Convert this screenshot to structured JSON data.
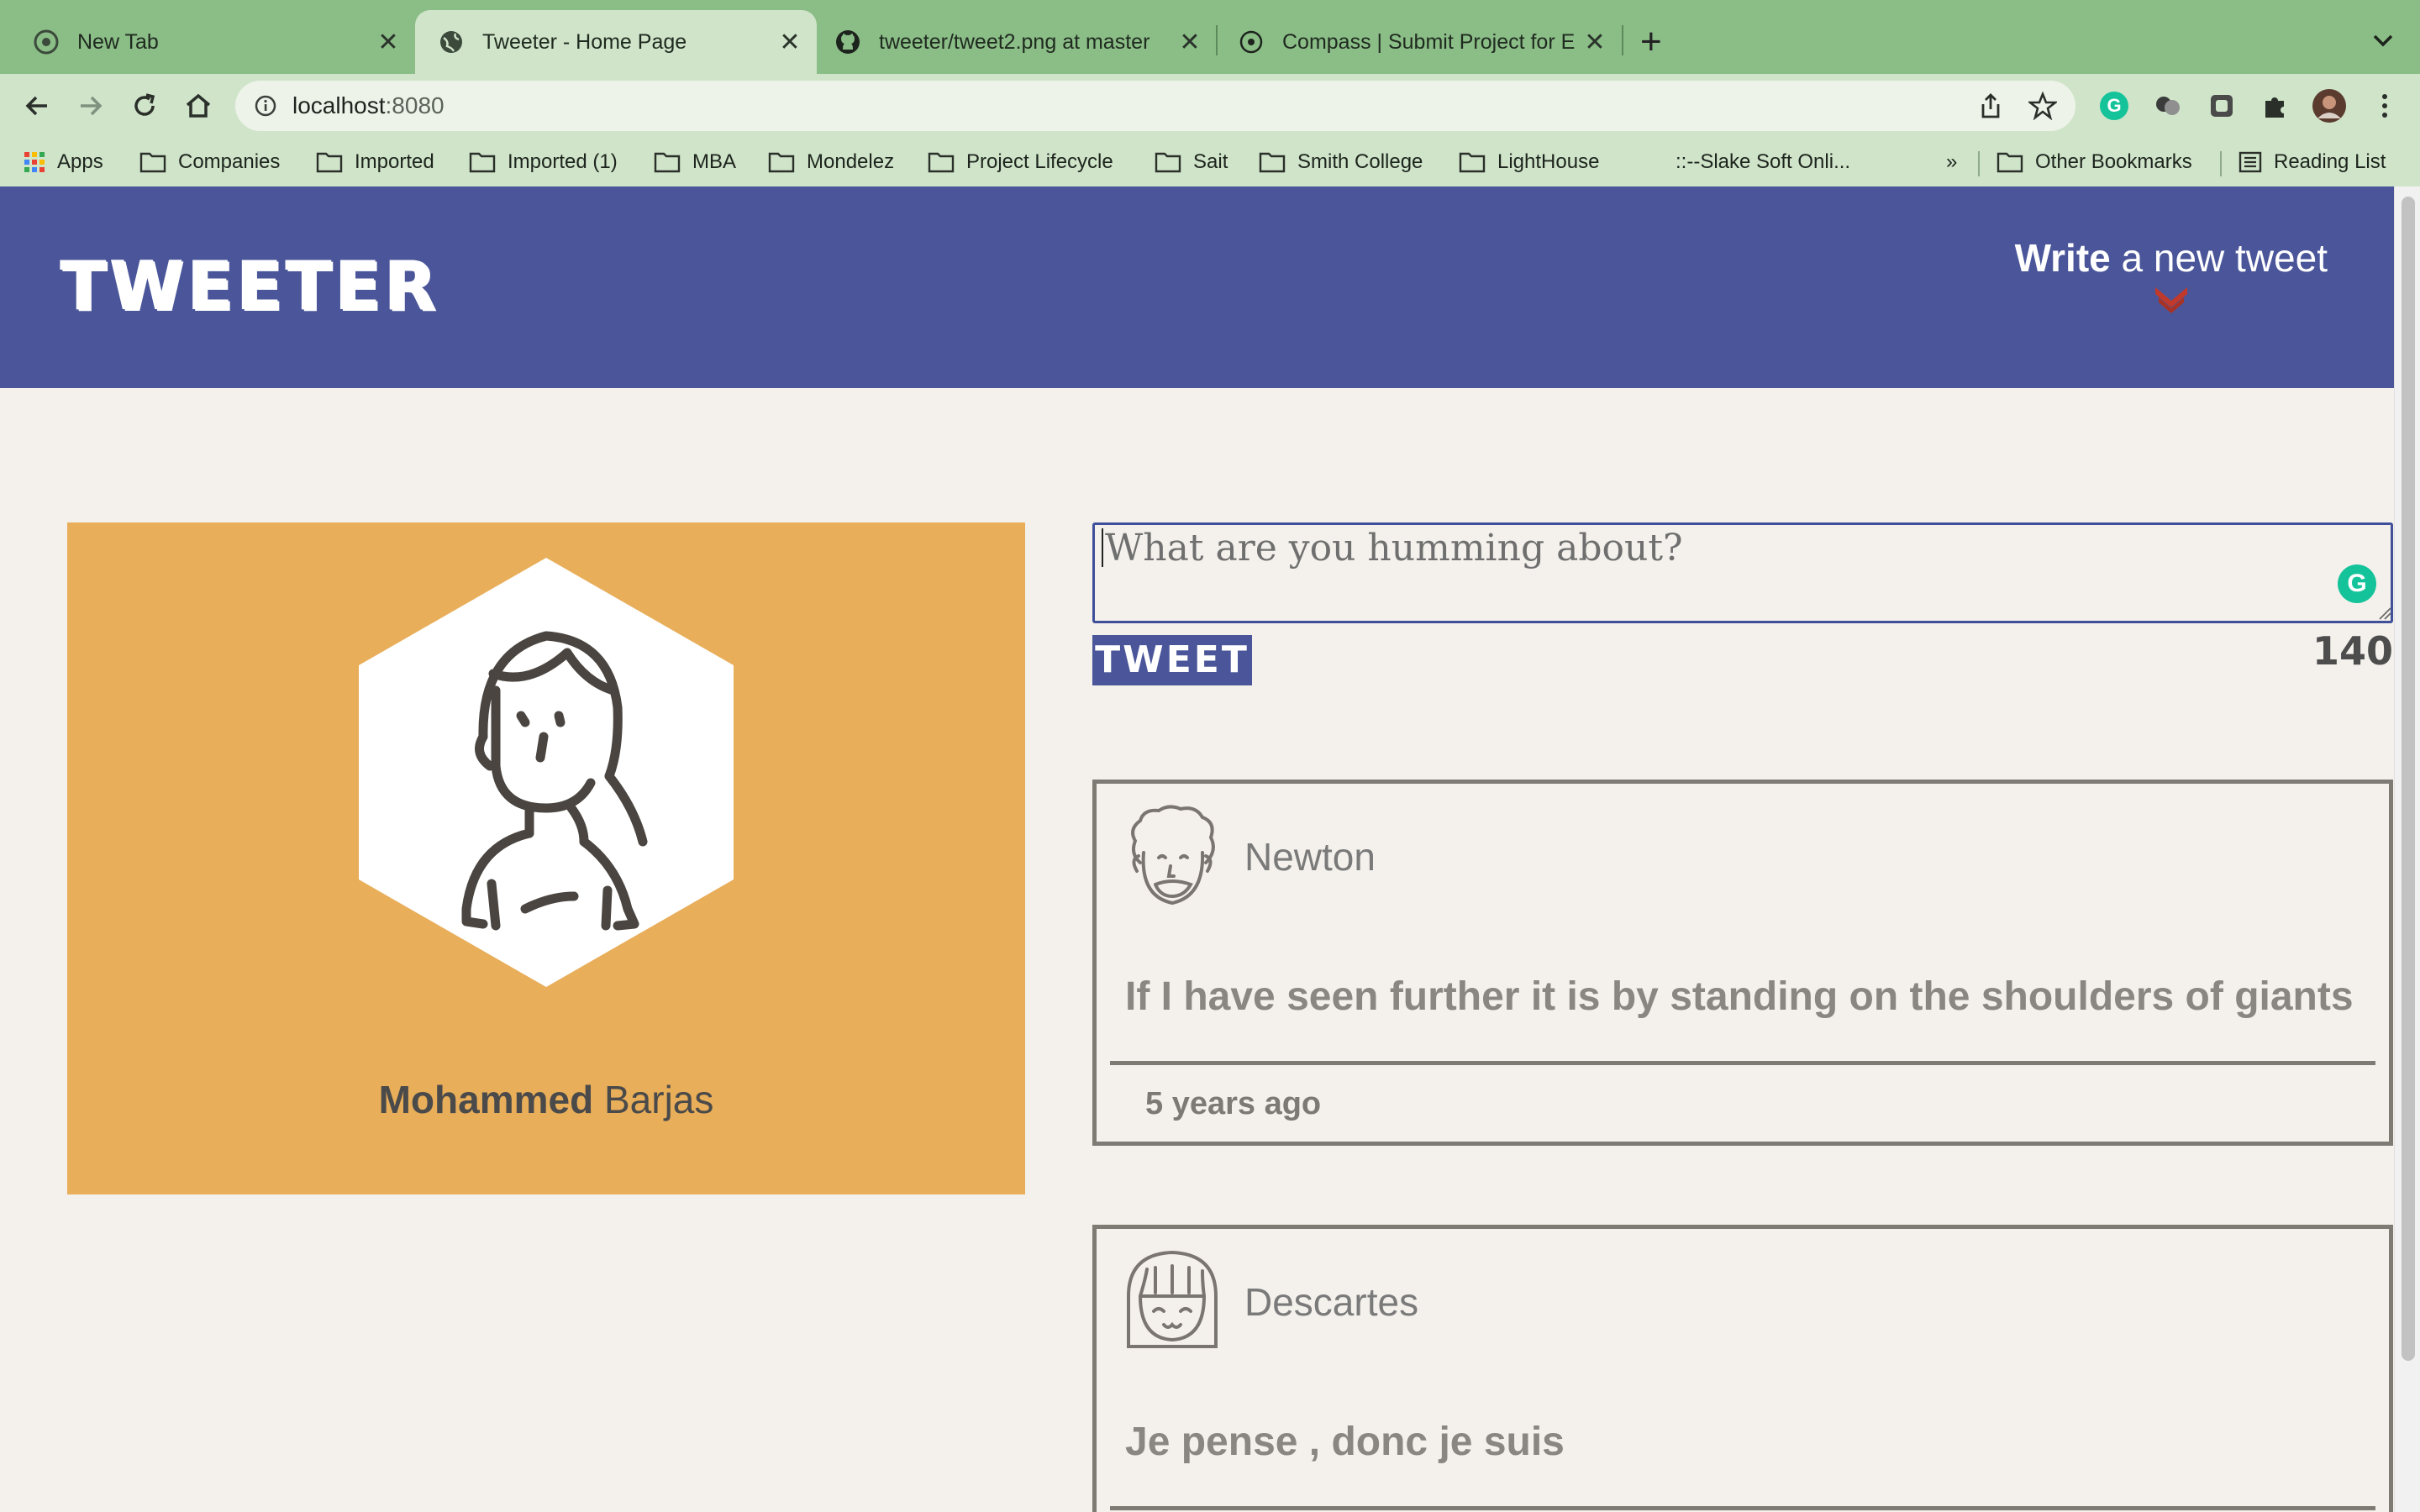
{
  "browser": {
    "tabs": [
      {
        "title": "New Tab",
        "icon": "chrome-icon",
        "active": false
      },
      {
        "title": "Tweeter - Home Page",
        "icon": "globe-icon",
        "active": true
      },
      {
        "title": "tweeter/tweet2.png at master",
        "icon": "github-icon",
        "active": false
      },
      {
        "title": "Compass | Submit Project for E",
        "icon": "compass-icon",
        "active": false
      }
    ],
    "new_tab_label": "+",
    "url_host": "localhost",
    "url_port": ":8080",
    "bookmarks": [
      {
        "label": "Apps",
        "icon": "apps-grid-icon"
      },
      {
        "label": "Companies",
        "icon": "folder-icon"
      },
      {
        "label": "Imported",
        "icon": "folder-icon"
      },
      {
        "label": "Imported (1)",
        "icon": "folder-icon"
      },
      {
        "label": "MBA",
        "icon": "folder-icon"
      },
      {
        "label": "Mondelez",
        "icon": "folder-icon"
      },
      {
        "label": "Project Lifecycle",
        "icon": "folder-icon"
      },
      {
        "label": "Sait",
        "icon": "folder-icon"
      },
      {
        "label": "Smith College",
        "icon": "folder-icon"
      },
      {
        "label": "LightHouse",
        "icon": "folder-icon"
      },
      {
        "label": "::--Slake Soft Onli...",
        "icon": "none"
      }
    ],
    "bookmarks_overflow": "»",
    "other_bookmarks": "Other Bookmarks",
    "reading_list": "Reading List"
  },
  "site": {
    "brand": "TWEETER",
    "compose_toggle_bold": "Write",
    "compose_toggle_rest": " a new tweet",
    "accent_color": "#4a5699",
    "card_color": "#e8ae5a",
    "profile": {
      "first_name": "Mohammed",
      "last_name": " Barjas"
    },
    "composer": {
      "placeholder": "What are you humming about?",
      "button_label": "TWEET",
      "counter": "140",
      "grammarly_badge": "G"
    },
    "tweets": [
      {
        "author": "Newton",
        "content": "If I have seen further it is by standing on the shoulders of giants",
        "time": "5 years ago"
      },
      {
        "author": "Descartes",
        "content": "Je pense , donc je suis",
        "time": ""
      }
    ]
  }
}
